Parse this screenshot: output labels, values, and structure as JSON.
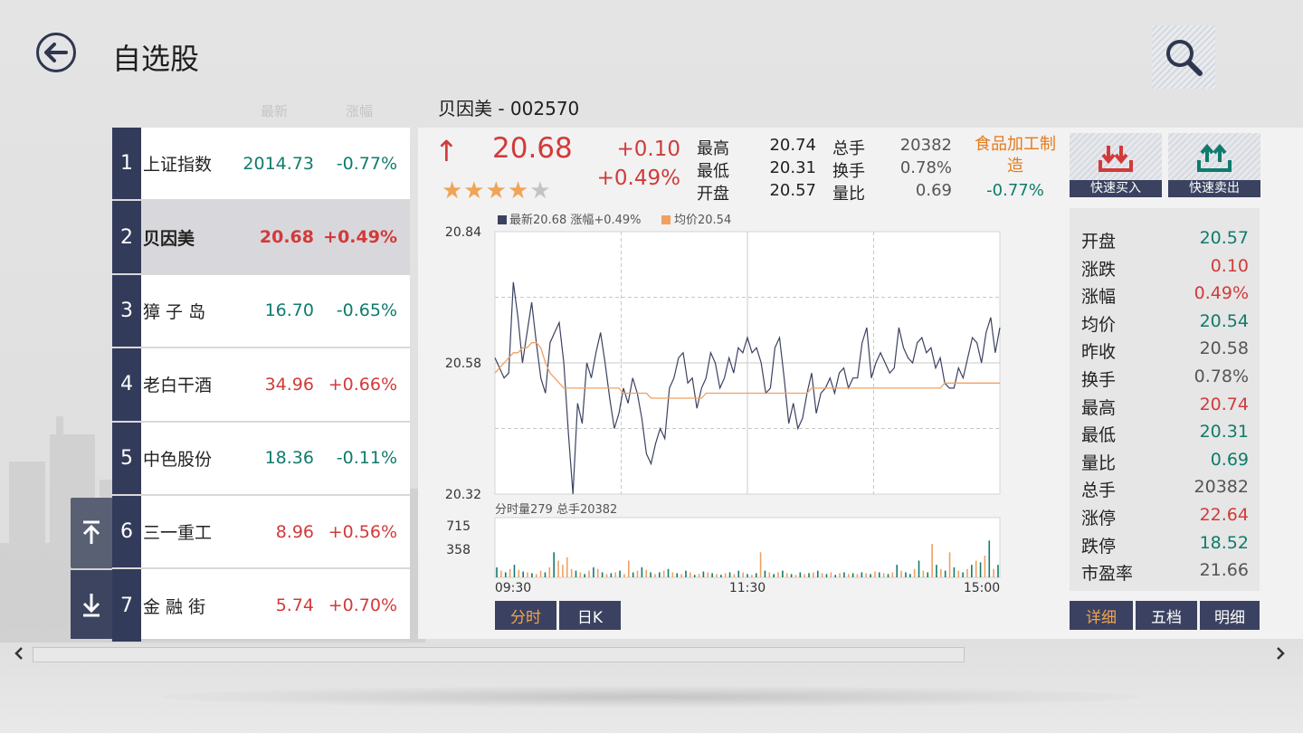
{
  "header": {
    "title": "自选股",
    "back_icon": "back-arrow-icon",
    "search_icon": "search-icon"
  },
  "columns": {
    "latest": "最新",
    "change": "涨幅"
  },
  "selected_stock": {
    "title": "贝因美 - 002570"
  },
  "colors": {
    "up": "#d23a3a",
    "down": "#0f7b6c",
    "navy": "#333b5b",
    "accent": "#f5a34c",
    "neutral": "#555555"
  },
  "watchlist": [
    {
      "num": "1",
      "name": "上证指数",
      "price": "2014.73",
      "change": "-0.77%",
      "dir": "down"
    },
    {
      "num": "2",
      "name": "贝因美",
      "price": "20.68",
      "change": "+0.49%",
      "dir": "up"
    },
    {
      "num": "3",
      "name": "獐 子 岛",
      "price": "16.70",
      "change": "-0.65%",
      "dir": "down"
    },
    {
      "num": "4",
      "name": "老白干酒",
      "price": "34.96",
      "change": "+0.66%",
      "dir": "up"
    },
    {
      "num": "5",
      "name": "中色股份",
      "price": "18.36",
      "change": "-0.11%",
      "dir": "down"
    },
    {
      "num": "6",
      "name": "三一重工",
      "price": "8.96",
      "change": "+0.56%",
      "dir": "up"
    },
    {
      "num": "7",
      "name": "金 融 街",
      "price": "5.74",
      "change": "+0.70%",
      "dir": "up"
    }
  ],
  "quote": {
    "price": "20.68",
    "change_abs": "+0.10",
    "change_pct": "+0.49%",
    "arrow": "↑",
    "stars": "★★★★",
    "star_empty": "★",
    "rating": 4,
    "fields": [
      {
        "label": "最高",
        "value": "20.74",
        "label2": "总手",
        "value2": "20382"
      },
      {
        "label": "最低",
        "value": "20.31",
        "label2": "换手",
        "value2": "0.78%"
      },
      {
        "label": "开盘",
        "value": "20.57",
        "label2": "量比",
        "value2": "0.69"
      }
    ],
    "industry": "食品加工制造",
    "industry_change": "-0.77%"
  },
  "actions": {
    "buy": "快速买入",
    "sell": "快速卖出"
  },
  "chart_data": {
    "type": "line",
    "legend": [
      "最新20.68 涨幅+0.49%",
      "均价20.54"
    ],
    "y_ticks": [
      "20.84",
      "20.58",
      "20.32"
    ],
    "ylim": [
      20.32,
      20.84
    ],
    "x_ticks": [
      "09:30",
      "11:30",
      "15:00"
    ],
    "series": [
      {
        "name": "最新",
        "color": "#3b4261",
        "values": [
          20.59,
          20.57,
          20.55,
          20.56,
          20.74,
          20.67,
          20.58,
          20.64,
          20.7,
          20.62,
          20.55,
          20.52,
          20.62,
          20.64,
          20.66,
          20.58,
          20.44,
          20.32,
          20.5,
          20.46,
          20.58,
          20.55,
          20.6,
          20.64,
          20.58,
          20.51,
          20.45,
          20.48,
          20.53,
          20.5,
          20.55,
          20.52,
          20.47,
          20.4,
          20.38,
          20.42,
          20.45,
          20.43,
          20.53,
          20.55,
          20.59,
          20.6,
          20.54,
          20.55,
          20.49,
          20.53,
          20.55,
          20.6,
          20.58,
          20.53,
          20.55,
          20.59,
          20.56,
          20.61,
          20.6,
          20.63,
          20.6,
          20.61,
          20.58,
          20.52,
          20.53,
          20.61,
          20.63,
          20.55,
          20.46,
          20.5,
          20.45,
          20.47,
          20.52,
          20.56,
          20.48,
          20.52,
          20.53,
          20.55,
          20.52,
          20.56,
          20.57,
          20.53,
          20.55,
          20.55,
          20.62,
          20.65,
          20.55,
          20.58,
          20.6,
          20.58,
          20.56,
          20.57,
          20.65,
          20.61,
          20.59,
          20.58,
          20.62,
          20.63,
          20.6,
          20.61,
          20.57,
          20.59,
          20.54,
          20.53,
          20.53,
          20.57,
          20.55,
          20.59,
          20.63,
          20.62,
          20.58,
          20.64,
          20.67,
          20.6,
          20.65
        ]
      },
      {
        "name": "均价",
        "color": "#f0a060",
        "values": [
          20.56,
          20.57,
          20.58,
          20.59,
          20.6,
          20.6,
          20.61,
          20.61,
          20.62,
          20.62,
          20.61,
          20.58,
          20.56,
          20.55,
          20.54,
          20.53,
          20.53,
          20.53,
          20.53,
          20.53,
          20.53,
          20.53,
          20.53,
          20.53,
          20.53,
          20.53,
          20.53,
          20.53,
          20.52,
          20.52,
          20.52,
          20.52,
          20.52,
          20.52,
          20.51,
          20.51,
          20.51,
          20.51,
          20.51,
          20.51,
          20.51,
          20.51,
          20.51,
          20.51,
          20.51,
          20.51,
          20.52,
          20.52,
          20.52,
          20.52,
          20.52,
          20.52,
          20.52,
          20.52,
          20.52,
          20.52,
          20.52,
          20.52,
          20.52,
          20.52,
          20.52,
          20.52,
          20.52,
          20.52,
          20.52,
          20.52,
          20.52,
          20.52,
          20.52,
          20.53,
          20.53,
          20.53,
          20.53,
          20.53,
          20.53,
          20.53,
          20.53,
          20.53,
          20.53,
          20.53,
          20.53,
          20.53,
          20.53,
          20.53,
          20.53,
          20.53,
          20.53,
          20.53,
          20.53,
          20.53,
          20.53,
          20.53,
          20.53,
          20.53,
          20.53,
          20.53,
          20.53,
          20.53,
          20.54,
          20.54,
          20.54,
          20.54,
          20.54,
          20.54,
          20.54,
          20.54,
          20.54,
          20.54,
          20.54,
          20.54,
          20.54
        ]
      }
    ],
    "volume": {
      "label": "分时量279 总手20382",
      "y_ticks": [
        "715",
        "358"
      ],
      "ymax": 715,
      "values": [
        120,
        80,
        60,
        100,
        150,
        90,
        70,
        60,
        50,
        40,
        80,
        60,
        120,
        300,
        200,
        150,
        240,
        100,
        80,
        60,
        40,
        80,
        120,
        100,
        60,
        40,
        50,
        60,
        80,
        40,
        200,
        60,
        80,
        120,
        90,
        60,
        40,
        60,
        80,
        100,
        60,
        50,
        40,
        80,
        60,
        30,
        40,
        70,
        60,
        50,
        40,
        30,
        50,
        60,
        40,
        80,
        60,
        40,
        30,
        50,
        300,
        80,
        60,
        40,
        60,
        80,
        50,
        40,
        30,
        60,
        40,
        50,
        60,
        80,
        50,
        40,
        60,
        30,
        50,
        60,
        40,
        50,
        40,
        60,
        50,
        40,
        70,
        60,
        50,
        40,
        60,
        150,
        80,
        60,
        40,
        100,
        200,
        80,
        60,
        400,
        150,
        100,
        80,
        300,
        120,
        80,
        60,
        100,
        150,
        200,
        180,
        260,
        440,
        100,
        150
      ],
      "colors": [
        "u",
        "d",
        "u",
        "d",
        "u",
        "d",
        "u",
        "d",
        "u",
        "d",
        "d",
        "u",
        "d",
        "u",
        "d",
        "d",
        "d",
        "d",
        "u",
        "d",
        "u",
        "d",
        "u",
        "d",
        "u",
        "d",
        "u",
        "d",
        "u",
        "d",
        "d",
        "u",
        "d",
        "u",
        "d",
        "u",
        "d",
        "u",
        "d",
        "u",
        "d",
        "u",
        "d",
        "u",
        "d",
        "u",
        "d",
        "u",
        "d",
        "u",
        "d",
        "u",
        "d",
        "u",
        "d",
        "u",
        "d",
        "u",
        "d",
        "u",
        "d",
        "u",
        "d",
        "u",
        "d",
        "u",
        "d",
        "u",
        "d",
        "u",
        "d",
        "u",
        "d",
        "u",
        "d",
        "u",
        "d",
        "u",
        "d",
        "u",
        "d",
        "u",
        "d",
        "u",
        "d",
        "u",
        "d",
        "u",
        "d",
        "u",
        "d",
        "u",
        "d",
        "u",
        "u",
        "d",
        "u",
        "d",
        "u",
        "d",
        "u",
        "d",
        "u",
        "d",
        "u",
        "d",
        "u",
        "d",
        "u",
        "d",
        "u",
        "d",
        "u",
        "d",
        "u"
      ]
    }
  },
  "chart_tabs": [
    {
      "label": "分时",
      "active": true
    },
    {
      "label": "日K",
      "active": false
    }
  ],
  "stats": [
    {
      "label": "开盘",
      "value": "20.57",
      "dir": "down"
    },
    {
      "label": "涨跌",
      "value": "0.10",
      "dir": "up"
    },
    {
      "label": "涨幅",
      "value": "0.49%",
      "dir": "up"
    },
    {
      "label": "均价",
      "value": "20.54",
      "dir": "down"
    },
    {
      "label": "昨收",
      "value": "20.58",
      "dir": "flat"
    },
    {
      "label": "换手",
      "value": "0.78%",
      "dir": "flat"
    },
    {
      "label": "最高",
      "value": "20.74",
      "dir": "up"
    },
    {
      "label": "最低",
      "value": "20.31",
      "dir": "down"
    },
    {
      "label": "量比",
      "value": "0.69",
      "dir": "down"
    },
    {
      "label": "总手",
      "value": "20382",
      "dir": "flat"
    },
    {
      "label": "涨停",
      "value": "22.64",
      "dir": "up"
    },
    {
      "label": "跌停",
      "value": "18.52",
      "dir": "down"
    },
    {
      "label": "市盈率",
      "value": "21.66",
      "dir": "flat"
    }
  ],
  "detail_tabs": [
    {
      "label": "详细",
      "active": true
    },
    {
      "label": "五档",
      "active": false
    },
    {
      "label": "明细",
      "active": false
    }
  ],
  "scroll": {
    "left_icon": "chevron-left-icon",
    "right_icon": "chevron-right-icon"
  },
  "sidebar_icons": {
    "up": "scroll-to-top-icon",
    "down": "scroll-down-icon"
  }
}
